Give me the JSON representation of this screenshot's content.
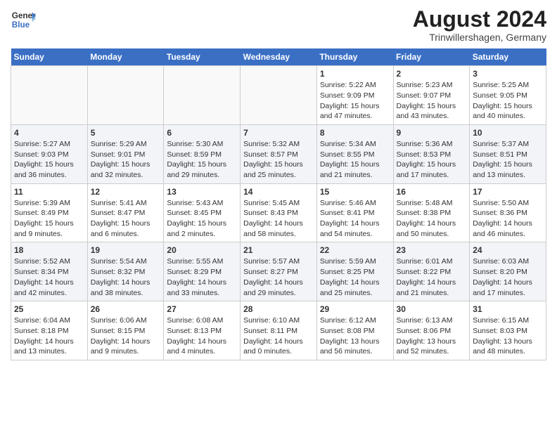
{
  "header": {
    "logo_line1": "General",
    "logo_line2": "Blue",
    "title": "August 2024",
    "subtitle": "Trinwillershagen, Germany"
  },
  "days_of_week": [
    "Sunday",
    "Monday",
    "Tuesday",
    "Wednesday",
    "Thursday",
    "Friday",
    "Saturday"
  ],
  "weeks": [
    [
      {
        "num": "",
        "info": ""
      },
      {
        "num": "",
        "info": ""
      },
      {
        "num": "",
        "info": ""
      },
      {
        "num": "",
        "info": ""
      },
      {
        "num": "1",
        "info": "Sunrise: 5:22 AM\nSunset: 9:09 PM\nDaylight: 15 hours\nand 47 minutes."
      },
      {
        "num": "2",
        "info": "Sunrise: 5:23 AM\nSunset: 9:07 PM\nDaylight: 15 hours\nand 43 minutes."
      },
      {
        "num": "3",
        "info": "Sunrise: 5:25 AM\nSunset: 9:05 PM\nDaylight: 15 hours\nand 40 minutes."
      }
    ],
    [
      {
        "num": "4",
        "info": "Sunrise: 5:27 AM\nSunset: 9:03 PM\nDaylight: 15 hours\nand 36 minutes."
      },
      {
        "num": "5",
        "info": "Sunrise: 5:29 AM\nSunset: 9:01 PM\nDaylight: 15 hours\nand 32 minutes."
      },
      {
        "num": "6",
        "info": "Sunrise: 5:30 AM\nSunset: 8:59 PM\nDaylight: 15 hours\nand 29 minutes."
      },
      {
        "num": "7",
        "info": "Sunrise: 5:32 AM\nSunset: 8:57 PM\nDaylight: 15 hours\nand 25 minutes."
      },
      {
        "num": "8",
        "info": "Sunrise: 5:34 AM\nSunset: 8:55 PM\nDaylight: 15 hours\nand 21 minutes."
      },
      {
        "num": "9",
        "info": "Sunrise: 5:36 AM\nSunset: 8:53 PM\nDaylight: 15 hours\nand 17 minutes."
      },
      {
        "num": "10",
        "info": "Sunrise: 5:37 AM\nSunset: 8:51 PM\nDaylight: 15 hours\nand 13 minutes."
      }
    ],
    [
      {
        "num": "11",
        "info": "Sunrise: 5:39 AM\nSunset: 8:49 PM\nDaylight: 15 hours\nand 9 minutes."
      },
      {
        "num": "12",
        "info": "Sunrise: 5:41 AM\nSunset: 8:47 PM\nDaylight: 15 hours\nand 6 minutes."
      },
      {
        "num": "13",
        "info": "Sunrise: 5:43 AM\nSunset: 8:45 PM\nDaylight: 15 hours\nand 2 minutes."
      },
      {
        "num": "14",
        "info": "Sunrise: 5:45 AM\nSunset: 8:43 PM\nDaylight: 14 hours\nand 58 minutes."
      },
      {
        "num": "15",
        "info": "Sunrise: 5:46 AM\nSunset: 8:41 PM\nDaylight: 14 hours\nand 54 minutes."
      },
      {
        "num": "16",
        "info": "Sunrise: 5:48 AM\nSunset: 8:38 PM\nDaylight: 14 hours\nand 50 minutes."
      },
      {
        "num": "17",
        "info": "Sunrise: 5:50 AM\nSunset: 8:36 PM\nDaylight: 14 hours\nand 46 minutes."
      }
    ],
    [
      {
        "num": "18",
        "info": "Sunrise: 5:52 AM\nSunset: 8:34 PM\nDaylight: 14 hours\nand 42 minutes."
      },
      {
        "num": "19",
        "info": "Sunrise: 5:54 AM\nSunset: 8:32 PM\nDaylight: 14 hours\nand 38 minutes."
      },
      {
        "num": "20",
        "info": "Sunrise: 5:55 AM\nSunset: 8:29 PM\nDaylight: 14 hours\nand 33 minutes."
      },
      {
        "num": "21",
        "info": "Sunrise: 5:57 AM\nSunset: 8:27 PM\nDaylight: 14 hours\nand 29 minutes."
      },
      {
        "num": "22",
        "info": "Sunrise: 5:59 AM\nSunset: 8:25 PM\nDaylight: 14 hours\nand 25 minutes."
      },
      {
        "num": "23",
        "info": "Sunrise: 6:01 AM\nSunset: 8:22 PM\nDaylight: 14 hours\nand 21 minutes."
      },
      {
        "num": "24",
        "info": "Sunrise: 6:03 AM\nSunset: 8:20 PM\nDaylight: 14 hours\nand 17 minutes."
      }
    ],
    [
      {
        "num": "25",
        "info": "Sunrise: 6:04 AM\nSunset: 8:18 PM\nDaylight: 14 hours\nand 13 minutes."
      },
      {
        "num": "26",
        "info": "Sunrise: 6:06 AM\nSunset: 8:15 PM\nDaylight: 14 hours\nand 9 minutes."
      },
      {
        "num": "27",
        "info": "Sunrise: 6:08 AM\nSunset: 8:13 PM\nDaylight: 14 hours\nand 4 minutes."
      },
      {
        "num": "28",
        "info": "Sunrise: 6:10 AM\nSunset: 8:11 PM\nDaylight: 14 hours\nand 0 minutes."
      },
      {
        "num": "29",
        "info": "Sunrise: 6:12 AM\nSunset: 8:08 PM\nDaylight: 13 hours\nand 56 minutes."
      },
      {
        "num": "30",
        "info": "Sunrise: 6:13 AM\nSunset: 8:06 PM\nDaylight: 13 hours\nand 52 minutes."
      },
      {
        "num": "31",
        "info": "Sunrise: 6:15 AM\nSunset: 8:03 PM\nDaylight: 13 hours\nand 48 minutes."
      }
    ]
  ]
}
